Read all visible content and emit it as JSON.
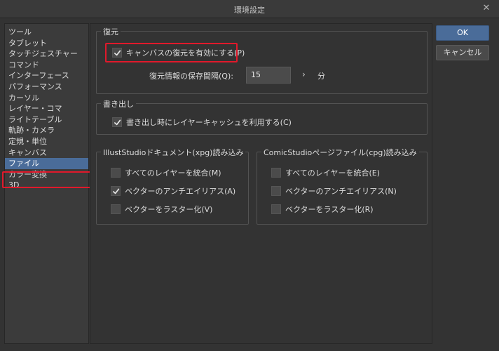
{
  "window": {
    "title": "環境設定"
  },
  "sidebar": {
    "items": [
      {
        "label": "ツール"
      },
      {
        "label": "タブレット"
      },
      {
        "label": "タッチジェスチャー"
      },
      {
        "label": "コマンド"
      },
      {
        "label": "インターフェース"
      },
      {
        "label": "パフォーマンス"
      },
      {
        "label": "カーソル"
      },
      {
        "label": "レイヤー・コマ"
      },
      {
        "label": "ライトテーブル"
      },
      {
        "label": "軌跡・カメラ"
      },
      {
        "label": "定規・単位"
      },
      {
        "label": "キャンバス"
      },
      {
        "label": "ファイル",
        "selected": true
      },
      {
        "label": "カラー変換"
      },
      {
        "label": "3D"
      }
    ]
  },
  "restore": {
    "legend": "復元",
    "enable_label": "キャンバスの復元を有効にする(P)",
    "enable_checked": true,
    "interval_label": "復元情報の保存間隔(Q):",
    "interval_value": "15",
    "interval_unit": "分"
  },
  "export": {
    "legend": "書き出し",
    "cache_label": "書き出し時にレイヤーキャッシュを利用する(C)",
    "cache_checked": true
  },
  "illust": {
    "legend": "IllustStudioドキュメント(xpg)読み込み",
    "options": [
      {
        "label": "すべてのレイヤーを統合(M)",
        "checked": false
      },
      {
        "label": "ベクターのアンチエイリアス(A)",
        "checked": true
      },
      {
        "label": "ベクターをラスター化(V)",
        "checked": false
      }
    ]
  },
  "comic": {
    "legend": "ComicStudioページファイル(cpg)読み込み",
    "options": [
      {
        "label": "すべてのレイヤーを統合(E)",
        "checked": false
      },
      {
        "label": "ベクターのアンチエイリアス(N)",
        "checked": false
      },
      {
        "label": "ベクターをラスター化(R)",
        "checked": false
      }
    ]
  },
  "buttons": {
    "ok": "OK",
    "cancel": "キャンセル"
  },
  "colors": {
    "accent": "#4a6c99",
    "highlight": "#e0192b",
    "background": "#333333"
  }
}
